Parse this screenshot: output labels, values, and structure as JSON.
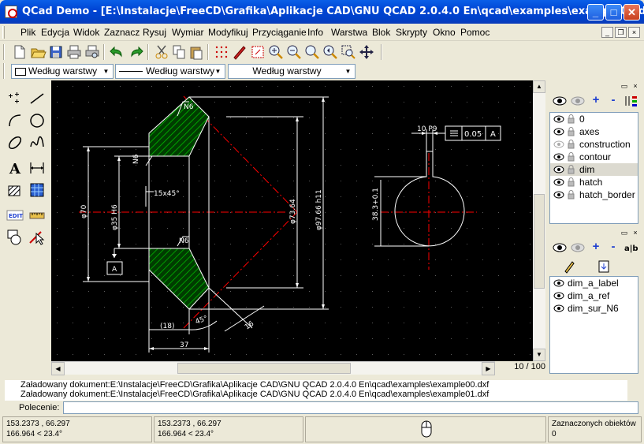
{
  "window": {
    "title": "QCad Demo - [E:\\Instalacje\\FreeCD\\Grafika\\Aplikacje CAD\\GNU QCAD 2.0.4.0 En\\qcad\\examples\\example01.dxf]",
    "minimize": "_",
    "maximize": "□",
    "close": "✕"
  },
  "menu": [
    "Plik",
    "Edycja",
    "Widok",
    "Zaznacz",
    "Rysuj",
    "Wymiar",
    "Modyfikuj",
    "Przyciąganie",
    "Info",
    "Warstwa",
    "Blok",
    "Skrypty",
    "Okno",
    "Pomoc"
  ],
  "pen": {
    "color": "Według warstwy",
    "width": "Według warstwy",
    "linetype": "Według warstwy"
  },
  "drawing": {
    "labels": {
      "n6_top": "N6",
      "n6_left": "N6",
      "n6_mid": "N6",
      "chamfer": "15x45°",
      "dia_left": "φ70",
      "dia_bore": "φ35 H6",
      "datum": "A",
      "dia_mid": "φ73.64",
      "dia_outer": "φ97.66 h11",
      "dim_18": "(18)",
      "angle_45": "45°",
      "dim_16": "16",
      "dim_37": "37",
      "dim_keyway": "10 P9",
      "tol_value": "0.05",
      "tol_datum": "A",
      "dim_38": "38.3+0.1"
    },
    "colors": {
      "background": "#000000",
      "lines": "#ffffff",
      "center": "#ff0000",
      "hatch": "#00c000",
      "grid": "#5a5a5a"
    }
  },
  "page_counter": "10 / 100",
  "layers": {
    "items": [
      {
        "name": "0",
        "visible": true
      },
      {
        "name": "axes",
        "visible": true
      },
      {
        "name": "construction",
        "visible": false
      },
      {
        "name": "contour",
        "visible": true
      },
      {
        "name": "dim",
        "visible": true,
        "selected": true
      },
      {
        "name": "hatch",
        "visible": true
      },
      {
        "name": "hatch_border",
        "visible": true
      }
    ]
  },
  "blocks": {
    "items": [
      "dim_a_label",
      "dim_a_ref",
      "dim_sur_N6"
    ]
  },
  "command_history": [
    "Załadowany dokument:E:\\Instalacje\\FreeCD\\Grafika\\Aplikacje CAD\\GNU QCAD 2.0.4.0 En\\qcad\\examples\\example00.dxf",
    "Załadowany dokument:E:\\Instalacje\\FreeCD\\Grafika\\Aplikacje CAD\\GNU QCAD 2.0.4.0 En\\qcad\\examples\\example01.dxf"
  ],
  "command_label": "Polecenie:",
  "status": {
    "abs_coord": "153.2373 , 66.297",
    "abs_polar": "166.964 < 23.4°",
    "rel_coord": "153.2373 , 66.297",
    "rel_polar": "166.964 < 23.4°",
    "selected_label": "Zaznaczonych obiektów",
    "selected_count": "0"
  }
}
